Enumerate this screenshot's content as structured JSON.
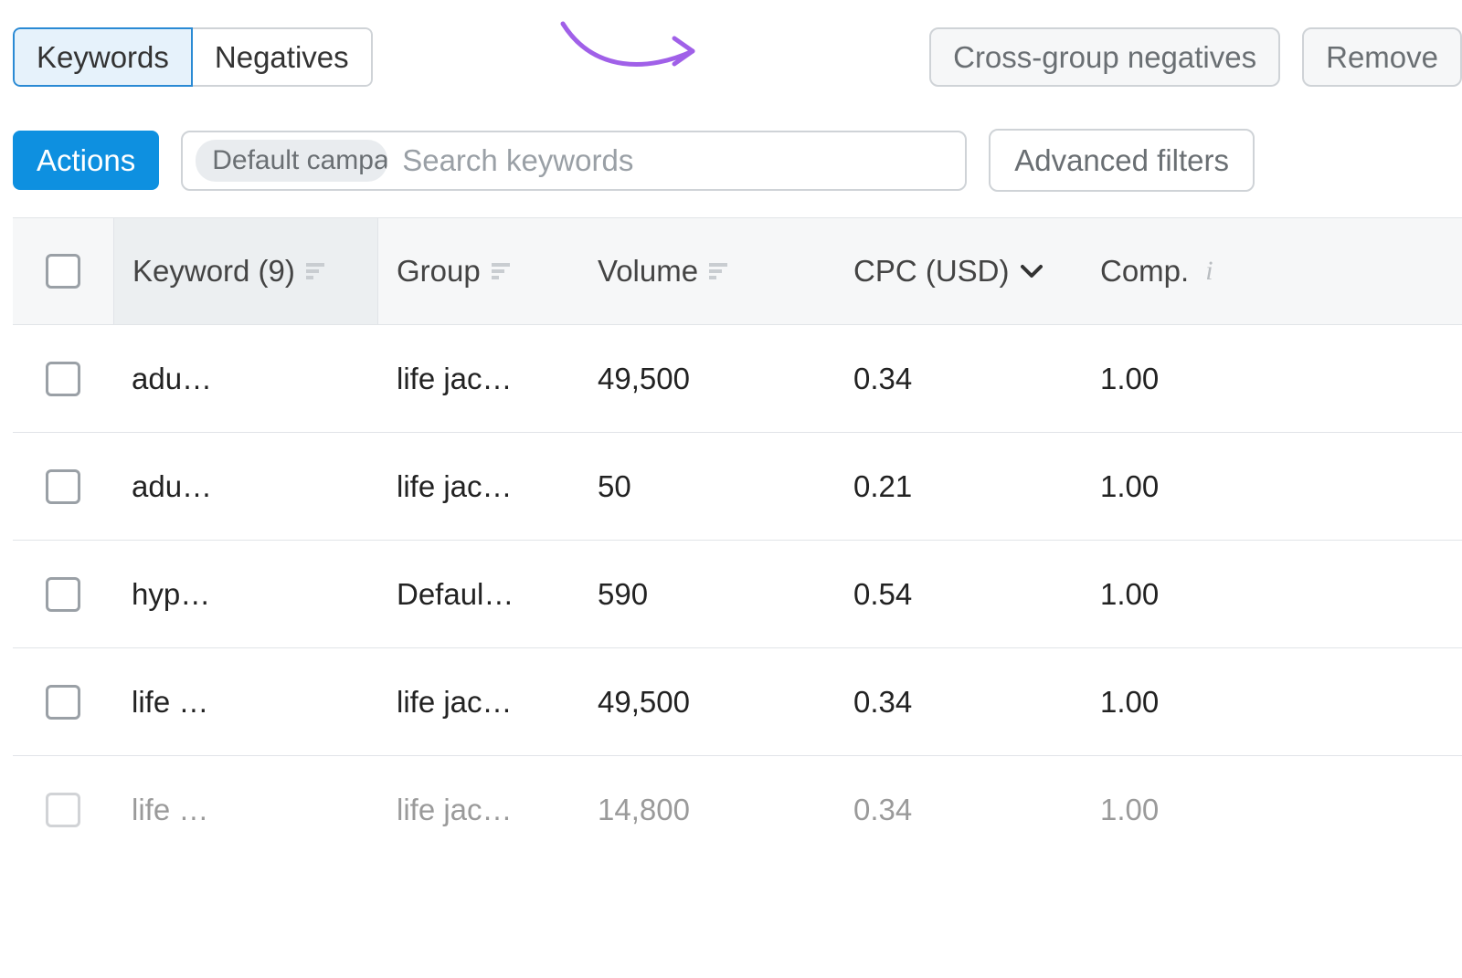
{
  "tabs": {
    "keywords": "Keywords",
    "negatives": "Negatives"
  },
  "buttons": {
    "cross_group_negatives": "Cross-group negatives",
    "remove": "Remove",
    "actions": "Actions",
    "advanced_filters": "Advanced filters"
  },
  "search": {
    "chip": "Default campa",
    "placeholder": "Search keywords"
  },
  "table": {
    "headers": {
      "keyword": "Keyword (9)",
      "group": "Group",
      "volume": "Volume",
      "cpc": "CPC (USD)",
      "comp": "Comp."
    },
    "rows": [
      {
        "keyword": "adu…",
        "group": "life jac…",
        "volume": "49,500",
        "cpc": "0.34",
        "comp": "1.00"
      },
      {
        "keyword": "adu…",
        "group": "life jac…",
        "volume": "50",
        "cpc": "0.21",
        "comp": "1.00"
      },
      {
        "keyword": "hyp…",
        "group": "Defaul…",
        "volume": "590",
        "cpc": "0.54",
        "comp": "1.00"
      },
      {
        "keyword": "life …",
        "group": "life jac…",
        "volume": "49,500",
        "cpc": "0.34",
        "comp": "1.00"
      },
      {
        "keyword": "life …",
        "group": "life jac…",
        "volume": "14,800",
        "cpc": "0.34",
        "comp": "1.00"
      }
    ]
  }
}
